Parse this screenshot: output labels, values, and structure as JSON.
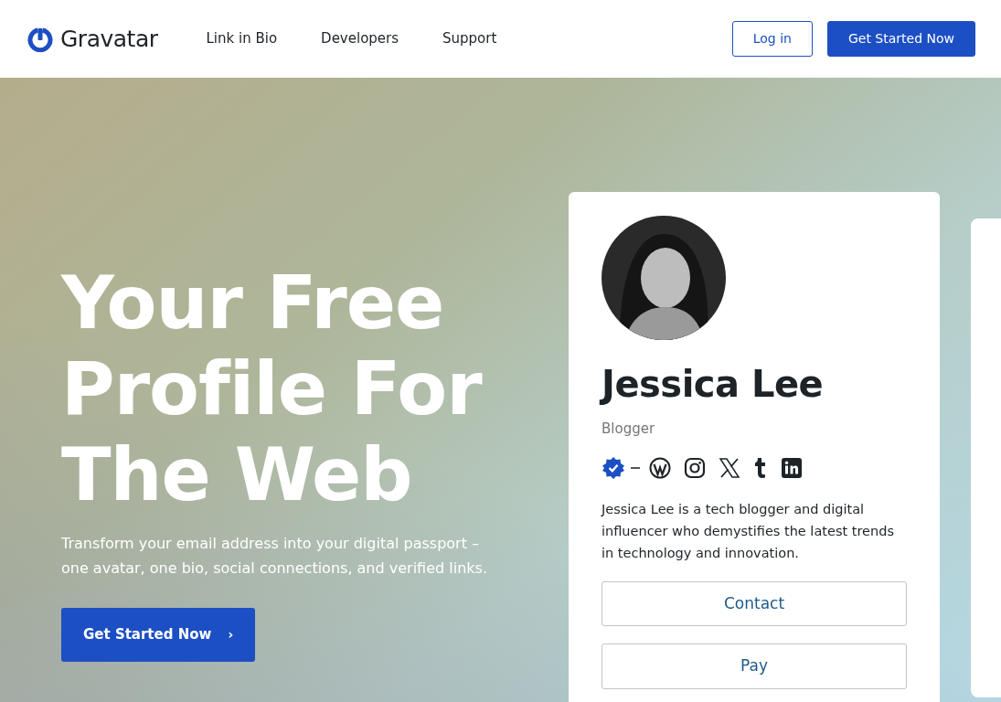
{
  "navbar": {
    "brand": "Gravatar",
    "links": [
      {
        "label": "Link in Bio"
      },
      {
        "label": "Developers"
      },
      {
        "label": "Support"
      }
    ],
    "buttons": [
      {
        "label": "Log in",
        "kind": "outline"
      },
      {
        "label": "Get Started Now",
        "kind": "solid"
      }
    ]
  },
  "hero": {
    "heading_lines": [
      "Your Free",
      "Profile For",
      "The Web"
    ],
    "subtitle": "Transform your email address into your digital passport – one avatar, one bio, social connections, and verified links.",
    "cta": {
      "label": "Get Started Now",
      "chevron": "›"
    }
  },
  "profile_card": {
    "name": "Jessica Lee",
    "role": "Blogger",
    "bio": "Jessica Lee is a tech blogger and digital influencer who demystifies the latest trends in technology and innovation.",
    "buttons": [
      {
        "label": "Contact"
      },
      {
        "label": "Pay"
      }
    ]
  }
}
